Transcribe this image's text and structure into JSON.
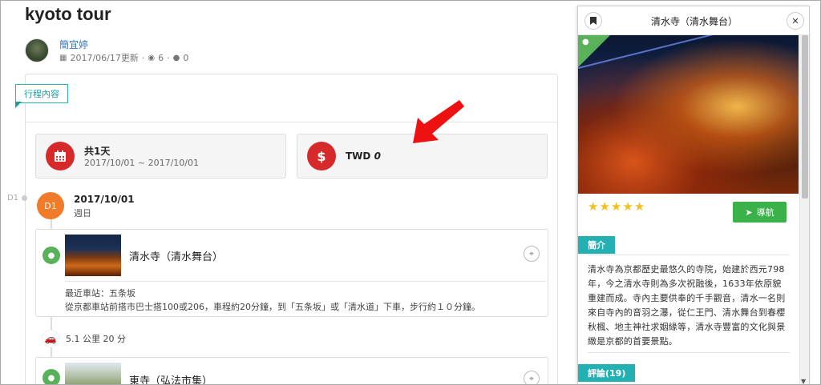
{
  "page": {
    "title": "kyoto tour",
    "author": "簡宜婷",
    "updated": "2017/06/17更新",
    "views": "6",
    "comments": "0",
    "tab_label": "行程內容"
  },
  "summary": {
    "days_label": "共1天",
    "date_range": "2017/10/01 ~ 2017/10/01",
    "currency": "TWD",
    "budget": "0"
  },
  "timeline": {
    "side_label": "D1",
    "day_badge": "D1",
    "day_date": "2017/10/01",
    "day_weekday": "週日",
    "spots": [
      {
        "name": "清水寺（清水舞台）",
        "station": "最近車站：五条坂",
        "directions": "從京都車站前搭市巴士搭100或206，車程約20分鐘，到「五条坂」或「清水道」下車，步行約１０分鐘。"
      },
      {
        "name": "東寺（弘法市集）"
      }
    ],
    "transit": "5.1 公里 20 分"
  },
  "panel": {
    "title": "清水寺（清水舞台）",
    "rating": 5,
    "nav_label": "導航",
    "intro_tag": "簡介",
    "intro_text": "清水寺為京都歷史最悠久的寺院，始建於西元798年，今之清水寺則為多次祝融後，1633年依原貌重建而成。寺內主要供奉的千手觀音，清水一名則來自寺內的音羽之瀑，從仁王門、清水舞台到春櫻秋楓、地主神社求姻緣等，清水寺豐富的文化與景緻是京都的首要景點。",
    "review_tag": "評論(19)"
  },
  "colors": {
    "accent_teal": "#23b0b3",
    "day_orange": "#f07c2a",
    "money_red": "#d62a2a",
    "pin_green": "#59b25a",
    "nav_green": "#3bb14a",
    "arrow_red": "#ee1111",
    "star_yellow": "#f2c01e"
  }
}
